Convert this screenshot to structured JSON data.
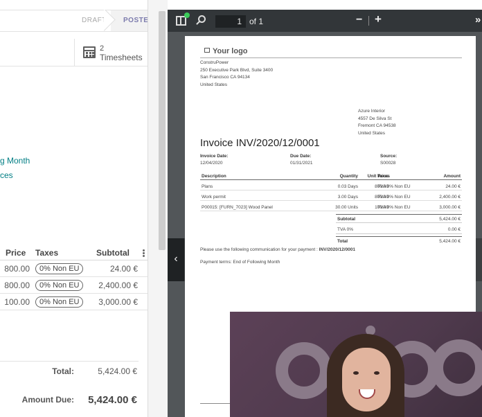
{
  "form": {
    "stages": {
      "draft": "DRAFT",
      "posted": "POSTED"
    },
    "timesheets": {
      "count": "2",
      "label": "Timesheets"
    },
    "payment_term_fragment": "g Month",
    "fragment_2": "ces",
    "lines": {
      "headers": {
        "price": "Price",
        "taxes": "Taxes",
        "subtotal": "Subtotal"
      },
      "rows": [
        {
          "price": "800.00",
          "tax": "0% Non EU",
          "subtotal": "24.00 €"
        },
        {
          "price": "800.00",
          "tax": "0% Non EU",
          "subtotal": "2,400.00 €"
        },
        {
          "price": "100.00",
          "tax": "0% Non EU",
          "subtotal": "3,000.00 €"
        }
      ]
    },
    "totals": {
      "total_label": "Total:",
      "total_value": "5,424.00 €",
      "due_label": "Amount Due:",
      "due_value": "5,424.00 €"
    }
  },
  "pdf": {
    "toolbar": {
      "page": "1",
      "of": "of 1",
      "zoom_out": "−",
      "zoom_in": "+",
      "more": "»",
      "prev": "‹"
    },
    "logo": "Your logo",
    "company": [
      "ConstruPower",
      "250 Executive Park Blvd, Suite 3400",
      "San Francisco CA 94134",
      "United States"
    ],
    "customer": [
      "Azure Interior",
      "4557 De Silva St",
      "Fremont CA 94538",
      "United States"
    ],
    "title": "Invoice INV/2020/12/0001",
    "meta": {
      "invoice_date_label": "Invoice Date:",
      "invoice_date": "12/04/2020",
      "due_date_label": "Due Date:",
      "due_date": "01/31/2021",
      "source_label": "Source:",
      "source": "S00028"
    },
    "table": {
      "headers": {
        "description": "Description",
        "quantity": "Quantity",
        "unit_price": "Unit Price",
        "taxes": "Taxes",
        "amount": "Amount"
      },
      "rows": [
        {
          "description": "Plans",
          "quantity": "0.03 Days",
          "unit_price": "800.00",
          "taxes": "TVA 0% Non EU",
          "amount": "24.00 €"
        },
        {
          "description": "Work permit",
          "quantity": "3.00 Days",
          "unit_price": "800.00",
          "taxes": "TVA 0% Non EU",
          "amount": "2,400.00 €"
        },
        {
          "description": "P00015: [FURN_7023] Wood Panel",
          "quantity": "30.00 Units",
          "unit_price": "100.00",
          "taxes": "TVA 0% Non EU",
          "amount": "3,000.00 €"
        }
      ]
    },
    "totals": {
      "subtotal_label": "Subtotal",
      "subtotal": "5,424.00 €",
      "tva_label": "TVA 0%",
      "tva": "0.00 €",
      "total_label": "Total",
      "total": "5,424.00 €"
    },
    "communication_prefix": "Please use the following communication for your payment : ",
    "communication_ref": "INV/2020/12/0001",
    "payment_terms": "Payment terms: End of Following Month"
  },
  "webcam": {
    "background_letters": "odoo"
  }
}
